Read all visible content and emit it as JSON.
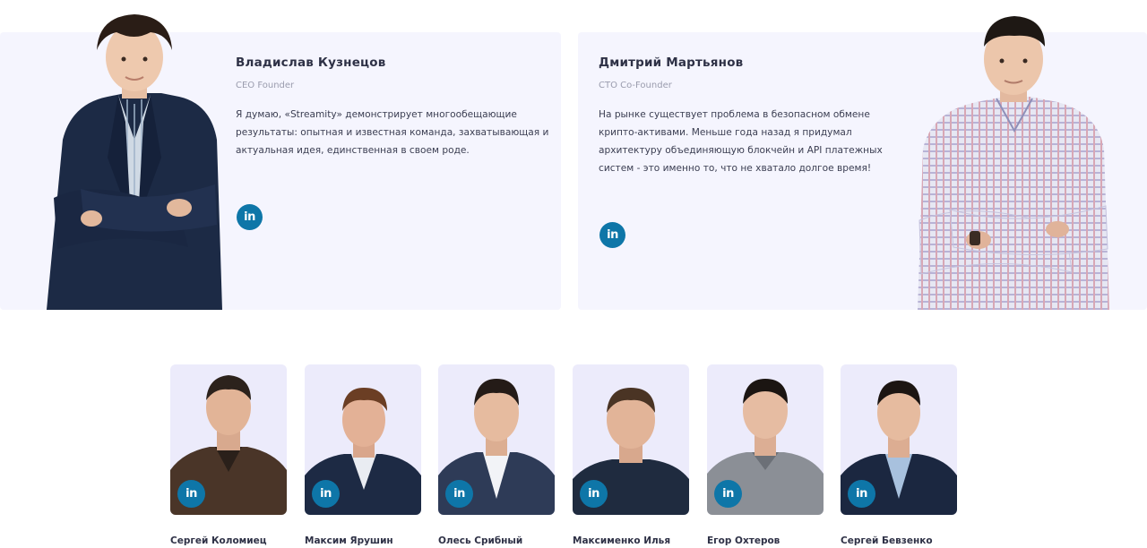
{
  "founders": [
    {
      "name": "Владислав Кузнецов",
      "role": "CEO Founder",
      "quote": "Я думаю, «Streamity» демонстрирует многообещающие результаты: опытная и известная команда, захватывающая и актуальная идея, единственная в своем роде.",
      "linkedin_icon": "linkedin-icon"
    },
    {
      "name": "Дмитрий Мартьянов",
      "role": "CTO Co-Founder",
      "quote": "На рынке существует проблема в безопасном обмене крипто-активами. Меньше года назад я придумал архитектуру объединяющую блокчейн и API платежных систем - это именно то, что не хватало долгое время!",
      "linkedin_icon": "linkedin-icon"
    }
  ],
  "team": [
    {
      "name": "Сергей Коломиец"
    },
    {
      "name": "Максим Ярушин"
    },
    {
      "name": "Олесь Срибный"
    },
    {
      "name": "Максименко Илья"
    },
    {
      "name": "Егор Охтеров"
    },
    {
      "name": "Сергей Бевзенко"
    }
  ],
  "linkedin_label": "in",
  "colors": {
    "card_background": "#f5f5fe",
    "member_background": "#ecebfb",
    "linkedin": "#0e76a8",
    "name_text": "#2e3146",
    "role_text": "#9a9cad"
  }
}
